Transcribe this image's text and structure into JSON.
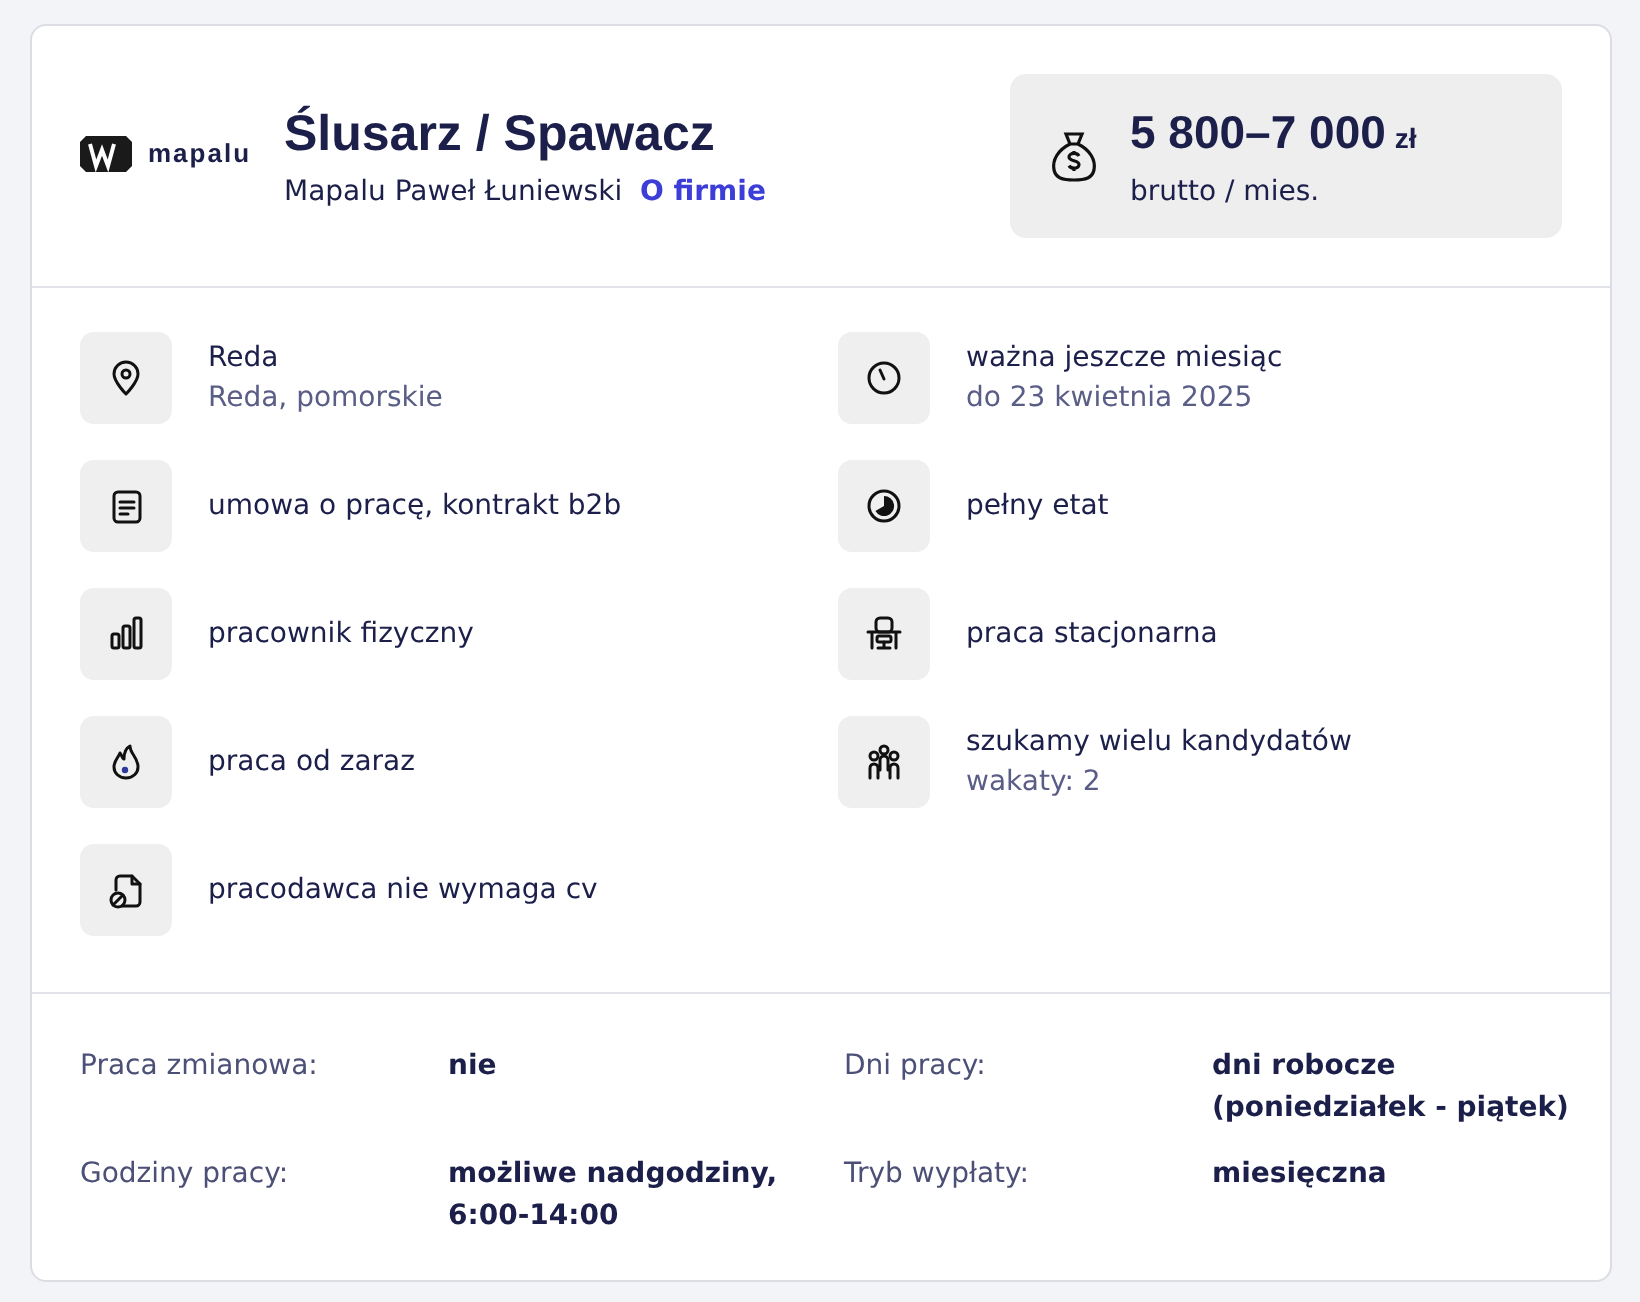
{
  "header": {
    "logo_text": "mapalu",
    "title": "Ślusarz / Spawacz",
    "company": "Mapalu Paweł Łuniewski",
    "company_link": "O firmie"
  },
  "salary": {
    "amount": "5 800–7 000",
    "currency": "zł",
    "note": "brutto / mies."
  },
  "features_left": [
    {
      "text": "Reda",
      "subtext": "Reda, pomorskie"
    },
    {
      "text": "umowa o pracę, kontrakt b2b"
    },
    {
      "text": "pracownik fizyczny"
    },
    {
      "text": "praca od zaraz"
    },
    {
      "text": "pracodawca nie wymaga cv"
    }
  ],
  "features_right": [
    {
      "text": "ważna jeszcze miesiąc",
      "subtext": "do 23 kwietnia 2025"
    },
    {
      "text": "pełny etat"
    },
    {
      "text": "praca stacjonarna"
    },
    {
      "text": "szukamy wielu kandydatów",
      "subtext": "wakaty: 2"
    }
  ],
  "details": [
    {
      "label": "Praca zmianowa:",
      "value": "nie"
    },
    {
      "label": "Dni pracy:",
      "value": "dni robocze (poniedziałek - piątek)"
    },
    {
      "label": "Godziny pracy:",
      "value": "możliwe nadgodziny, 6:00-14:00"
    },
    {
      "label": "Tryb wypłaty:",
      "value": "miesięczna"
    }
  ]
}
